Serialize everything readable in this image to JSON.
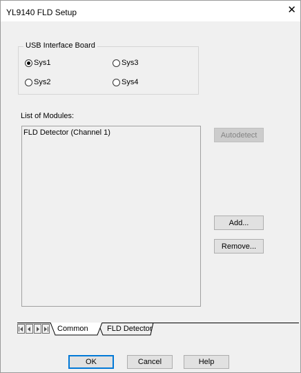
{
  "window": {
    "title": "YL9140 FLD Setup",
    "close_glyph": "✕"
  },
  "usb_group": {
    "title": "USB Interface Board",
    "options": [
      {
        "label": "Sys1",
        "selected": true
      },
      {
        "label": "Sys2",
        "selected": false
      },
      {
        "label": "Sys3",
        "selected": false
      },
      {
        "label": "Sys4",
        "selected": false
      }
    ]
  },
  "modules": {
    "label": "List of Modules:",
    "items": [
      "FLD Detector (Channel 1)"
    ]
  },
  "side_buttons": {
    "autodetect": "Autodetect",
    "add": "Add...",
    "remove": "Remove..."
  },
  "tabs": {
    "items": [
      {
        "label": "Common",
        "active": true
      },
      {
        "label": "FLD Detector",
        "active": false
      }
    ]
  },
  "footer": {
    "ok": "OK",
    "cancel": "Cancel",
    "help": "Help"
  }
}
